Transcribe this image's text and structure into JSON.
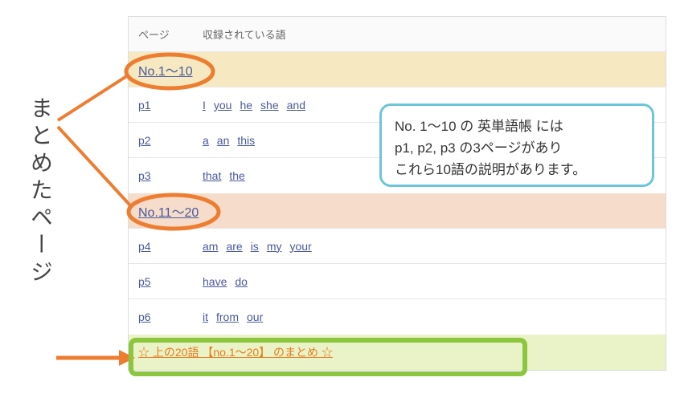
{
  "vertical_label": "まとめたページ",
  "header": {
    "col_page": "ページ",
    "col_words": "収録されている語"
  },
  "section1": {
    "link": "No.1～10"
  },
  "rows1": [
    {
      "page": "p1",
      "words": [
        "I",
        "you",
        "he",
        "she",
        "and"
      ]
    },
    {
      "page": "p2",
      "words": [
        "a",
        "an",
        "this"
      ]
    },
    {
      "page": "p3",
      "words": [
        "that",
        "the"
      ]
    }
  ],
  "section2": {
    "link": "No.11～20"
  },
  "rows2": [
    {
      "page": "p4",
      "words": [
        "am",
        "are",
        "is",
        "my",
        "your"
      ]
    },
    {
      "page": "p5",
      "words": [
        "have",
        "do"
      ]
    },
    {
      "page": "p6",
      "words": [
        "it",
        "from",
        "our"
      ]
    }
  ],
  "summary": {
    "star": "☆",
    "text": "上の20語 【no.1～20】 のまとめ"
  },
  "balloon": {
    "line1": "No. 1～10 の 英単語帳 には",
    "line2": "p1, p2, p3 の3ページがあり",
    "line3": "これら10語の説明があります。"
  }
}
